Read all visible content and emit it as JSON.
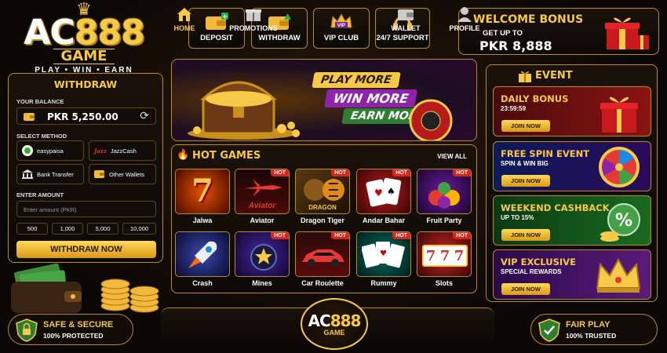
{
  "logo": {
    "brand_left": "AC",
    "brand_num": "888",
    "game": "GAME",
    "tagline": "PLAY • WIN • EARN"
  },
  "topnav": [
    {
      "label": "DEPOSIT",
      "icon": "wallet-plus-icon"
    },
    {
      "label": "WITHDRAW",
      "icon": "wallet-up-icon"
    },
    {
      "label": "VIP CLUB",
      "icon": "crown-icon"
    },
    {
      "label": "24/7 SUPPORT",
      "icon": "headset-icon"
    }
  ],
  "welcome": {
    "title": "WELCOME BONUS",
    "sub": "GET UP TO",
    "amount": "PKR 8,888"
  },
  "withdraw": {
    "title": "WITHDRAW",
    "balance_label": "YOUR BALANCE",
    "balance": "PKR 5,250.00",
    "method_label": "SELECT METHOD",
    "methods": [
      "easypaisa",
      "JazzCash",
      "Bank Transfer",
      "Other Wallets"
    ],
    "amount_label": "ENTER AMOUNT",
    "amount_placeholder": "Enter amount (PKR)",
    "quick": [
      "500",
      "1,000",
      "5,000",
      "10,000"
    ],
    "button": "WITHDRAW NOW"
  },
  "banner": {
    "l1": "PLAY MORE",
    "l2": "WIN MORE",
    "l3": "EARN MORE"
  },
  "hot": {
    "title": "HOT GAMES",
    "view_all": "VIEW ALL",
    "hot_badge": "HOT",
    "games": [
      "Jalwa",
      "Aviator",
      "Dragon Tiger",
      "Andar Bahar",
      "Fruit Party",
      "Crash",
      "Mines",
      "Car Roulette",
      "Rummy",
      "Slots"
    ],
    "tile_texts": {
      "aviator": "Aviator",
      "dragon": "DRAGON"
    }
  },
  "event": {
    "title": "EVENT",
    "cards": [
      {
        "title": "DAILY BONUS",
        "sub": "23:59:59",
        "btn": "JOIN NOW"
      },
      {
        "title": "FREE SPIN EVENT",
        "sub": "SPIN & WIN BIG",
        "btn": "JOIN NOW"
      },
      {
        "title": "WEEKEND CASHBACK",
        "sub": "UP TO 15%",
        "btn": "JOIN NOW"
      },
      {
        "title": "VIP EXCLUSIVE",
        "sub": "SPECIAL REWARDS",
        "btn": "JOIN NOW"
      }
    ]
  },
  "bottom": {
    "nav": [
      "HOME",
      "PROMOTIONS",
      "WALLET",
      "PROFILE"
    ]
  },
  "badges": {
    "left": {
      "title": "SAFE & SECURE",
      "sub": "100% PROTECTED"
    },
    "right": {
      "title": "FAIR PLAY",
      "sub": "100% TRUSTED"
    }
  },
  "vip_badge": "VIP",
  "colors": {
    "gold": "#f7c948",
    "accent_red": "#d9251a"
  }
}
